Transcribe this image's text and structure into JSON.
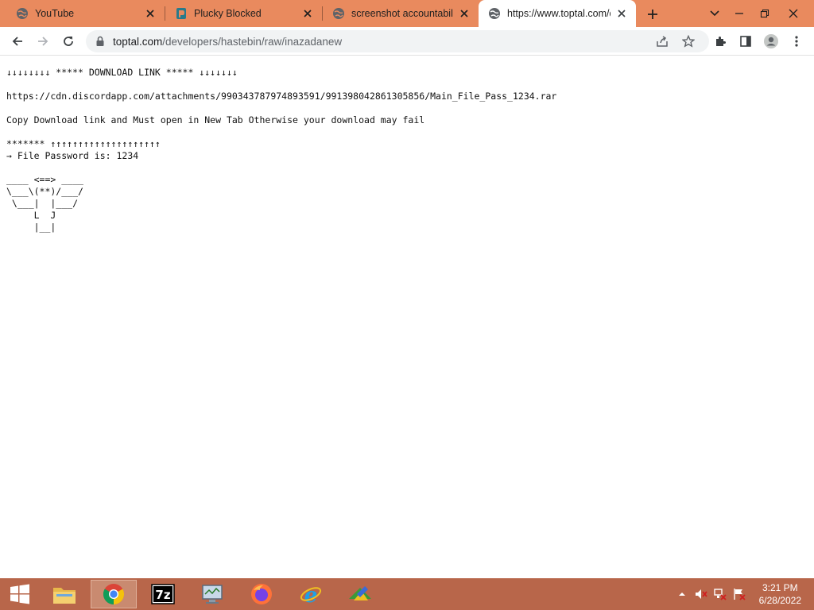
{
  "browser": {
    "tabs": [
      {
        "title": "YouTube",
        "icon": "globe-icon",
        "active": false
      },
      {
        "title": "Plucky Blocked",
        "icon": "plucky-icon",
        "active": false
      },
      {
        "title": "screenshot accountability",
        "icon": "globe-icon",
        "active": false
      },
      {
        "title": "https://www.toptal.com/developers/hastebin/raw/inazadanew",
        "icon": "globe-icon",
        "active": true
      }
    ],
    "address": {
      "host": "toptal.com",
      "path": "/developers/hastebin/raw/inazadanew"
    }
  },
  "content": {
    "lines": [
      "↓↓↓↓↓↓↓↓ ***** DOWNLOAD LINK ***** ↓↓↓↓↓↓↓",
      "https://cdn.discordapp.com/attachments/990343787974893591/991398042861305856/Main_File_Pass_1234.rar",
      "Copy Download link and Must open in New Tab Otherwise your download may fail",
      "******* ↑↑↑↑↑↑↑↑↑↑↑↑↑↑↑↑↑↑↑↑",
      "→ File Password is: 1234"
    ],
    "ascii_art": "____ <==> ____\n\\___\\(**)/___/\n \\___|  |___/\n     L  J\n     |__|"
  },
  "taskbar": {
    "apps": [
      "file-explorer",
      "chrome",
      "7-zip",
      "control-panel",
      "firefox",
      "internet-explorer",
      "unknown-app"
    ],
    "active_app": "chrome",
    "clock": {
      "time": "3:21 PM",
      "date": "6/28/2022"
    }
  },
  "colors": {
    "tabstrip": "#e98a5e",
    "taskbar": "#b8664a"
  }
}
